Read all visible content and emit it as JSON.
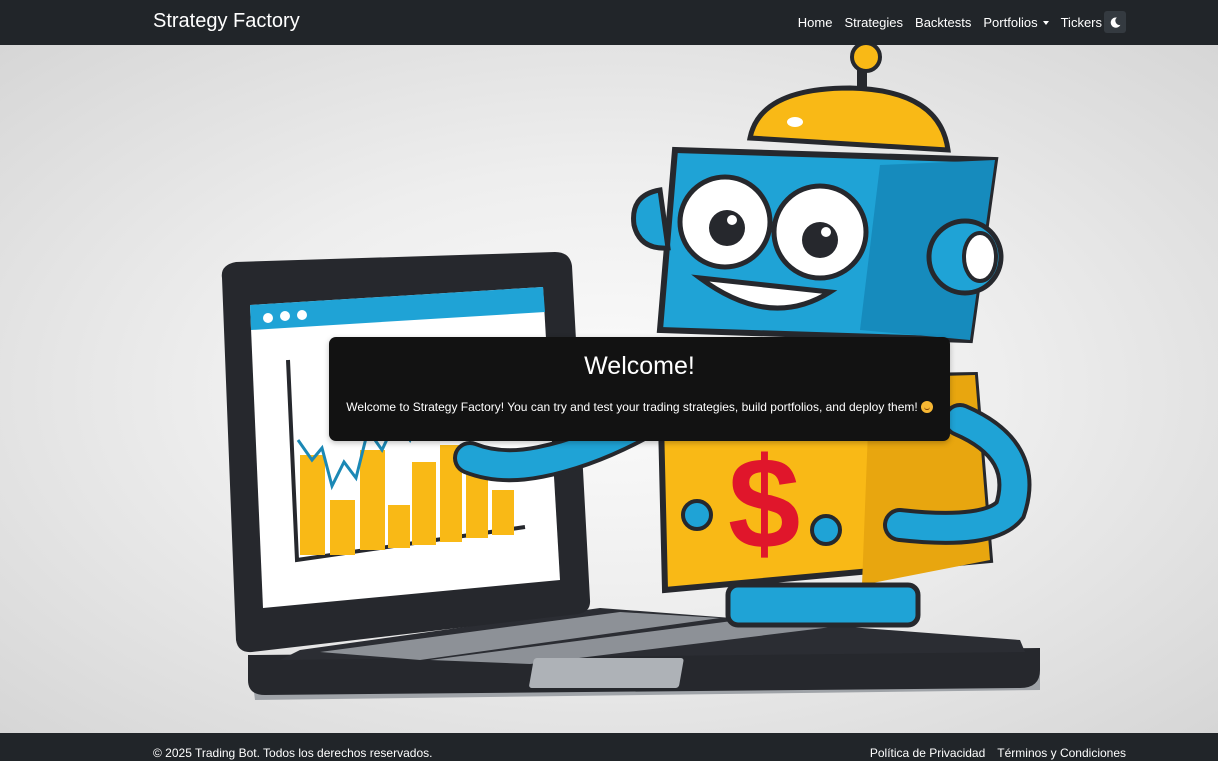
{
  "navbar": {
    "brand": "Strategy Factory",
    "links": [
      {
        "label": "Home"
      },
      {
        "label": "Strategies"
      },
      {
        "label": "Backtests"
      },
      {
        "label": "Portfolios"
      },
      {
        "label": "Tickers"
      }
    ],
    "user_icon": "user-icon",
    "theme_icon": "moon-icon"
  },
  "hero": {
    "illustration": "robot-with-laptop-trading-chart",
    "robot_symbol": "$"
  },
  "welcome": {
    "title": "Welcome!",
    "text": "Welcome to Strategy Factory! You can try and test your trading strategies, build portfolios, and deploy them!",
    "emoji": "smiling-face-emoji"
  },
  "footer": {
    "copyright": "© 2025 Trading Bot. Todos los derechos reservados.",
    "privacy": "Política de Privacidad",
    "terms": "Términos y Condiciones"
  },
  "colors": {
    "navbar": "#212529",
    "card": "#121212",
    "robot_blue": "#1fa3d6",
    "robot_yellow": "#f9b916",
    "dollar_red": "#e0162b"
  }
}
